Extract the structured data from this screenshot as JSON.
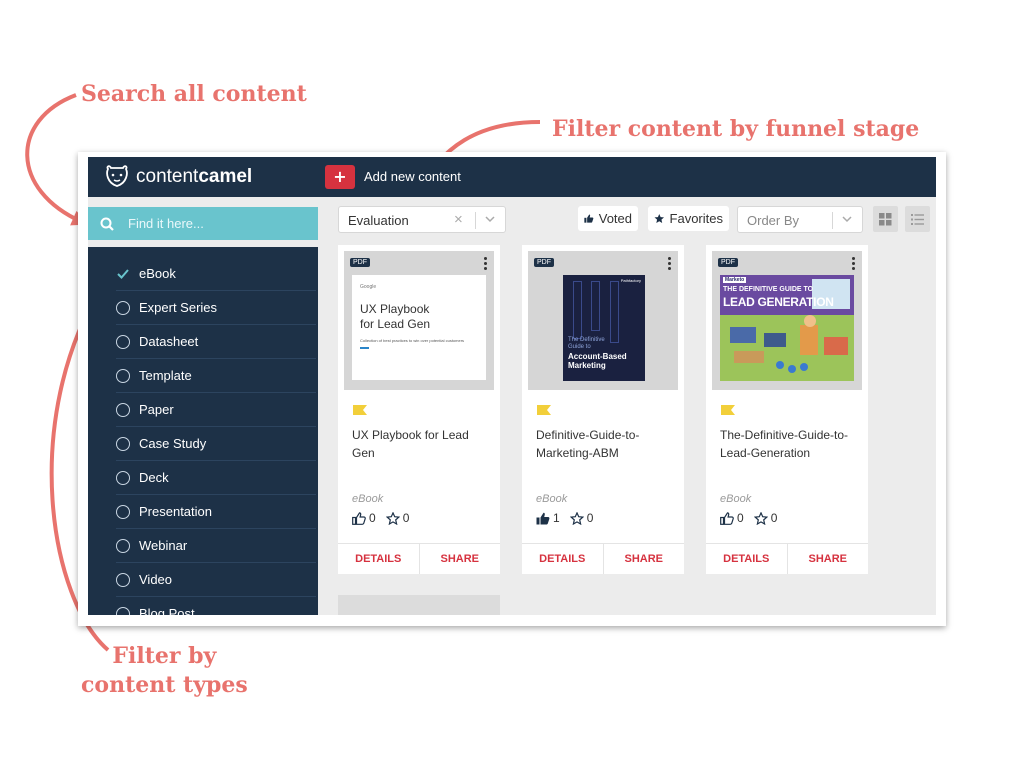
{
  "annotations": {
    "search": "Search all content",
    "funnel": "Filter content by funnel stage",
    "types_line1": "Filter by",
    "types_line2": "content types"
  },
  "app": {
    "logo_light": "content",
    "logo_bold": "camel",
    "add_button_icon": "+",
    "add_label": "Add new content"
  },
  "search": {
    "placeholder": "Find it here..."
  },
  "sidebar": {
    "items": [
      {
        "label": "eBook",
        "checked": true
      },
      {
        "label": "Expert Series",
        "checked": false
      },
      {
        "label": "Datasheet",
        "checked": false
      },
      {
        "label": "Template",
        "checked": false
      },
      {
        "label": "Paper",
        "checked": false
      },
      {
        "label": "Case Study",
        "checked": false
      },
      {
        "label": "Deck",
        "checked": false
      },
      {
        "label": "Presentation",
        "checked": false
      },
      {
        "label": "Webinar",
        "checked": false
      },
      {
        "label": "Video",
        "checked": false
      },
      {
        "label": "Blog Post",
        "checked": false
      }
    ]
  },
  "toolbar": {
    "funnel_value": "Evaluation",
    "clear_icon": "×",
    "voted_label": "Voted",
    "favorites_label": "Favorites",
    "order_placeholder": "Order By"
  },
  "cards": [
    {
      "badge": "PDF",
      "thumb_brand": "Google",
      "thumb_title_1": "UX Playbook",
      "thumb_title_2": "for Lead Gen",
      "thumb_sub": "Collection of best practices to win over potential customers",
      "title": "UX Playbook for Lead Gen",
      "type": "eBook",
      "likes": "0",
      "stars": "0",
      "liked": false,
      "details": "DETAILS",
      "share": "SHARE"
    },
    {
      "badge": "PDF",
      "thumb_brand": "Pathfactory",
      "thumb_title_1": "The Definitive",
      "thumb_title_2": "Guide to",
      "thumb_title_3": "Account-Based",
      "thumb_title_4": "Marketing",
      "title": "Definitive-Guide-to-Marketing-ABM",
      "type": "eBook",
      "likes": "1",
      "stars": "0",
      "liked": true,
      "details": "DETAILS",
      "share": "SHARE"
    },
    {
      "badge": "PDF",
      "thumb_brand": "Marketo",
      "thumb_title_1": "THE DEFINITIVE GUIDE TO",
      "thumb_title_2": "LEAD GENERATION",
      "title": "The-Definitive-Guide-to-Lead-Generation",
      "type": "eBook",
      "likes": "0",
      "stars": "0",
      "liked": false,
      "details": "DETAILS",
      "share": "SHARE"
    }
  ],
  "colors": {
    "navy": "#1d3147",
    "teal": "#69c4cd",
    "accent_red": "#d6323f",
    "annotation": "#e8736d"
  }
}
